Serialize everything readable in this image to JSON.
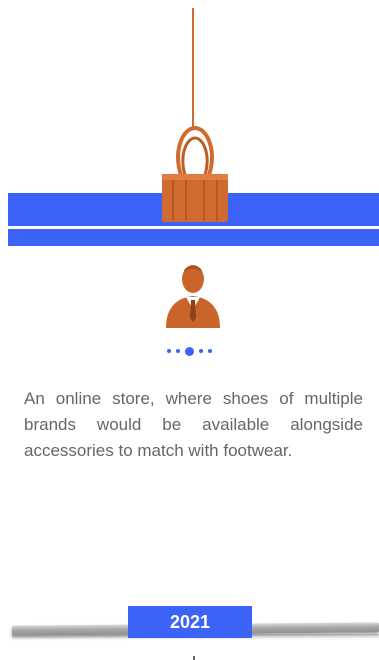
{
  "card": {
    "description": "An online store, where shoes of multiple brands would be available alongside accessories to match with footwear.",
    "year": "2021"
  },
  "icons": {
    "clip": "binder-clip-icon",
    "avatar": "businessman-avatar-icon"
  },
  "carousel": {
    "dot_count": 5,
    "active_index": 2
  },
  "colors": {
    "accent": "#3b63f7",
    "clip": "#d36a2e",
    "text": "#666666"
  }
}
